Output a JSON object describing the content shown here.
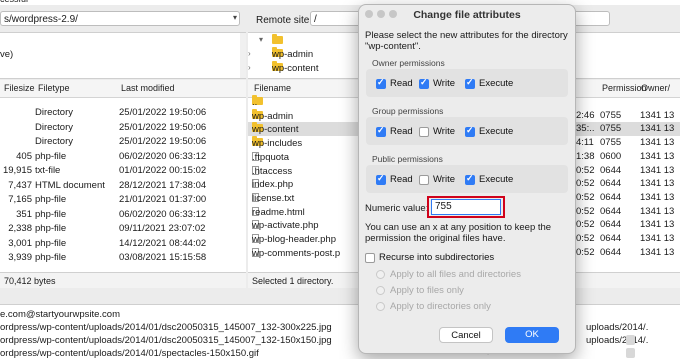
{
  "status_top": "cessful",
  "local_site": {
    "path": "s/wordpress-2.9/"
  },
  "remote_site": {
    "label": "Remote site:",
    "path": "/"
  },
  "local_tree": {
    "item": "ve)"
  },
  "remote_tree": {
    "items": [
      "wp-admin",
      "wp-content"
    ]
  },
  "local_list": {
    "columns": [
      "Filesize",
      "Filetype",
      "Last modified"
    ],
    "rows": [
      {
        "size": "",
        "type": "Directory",
        "modified": "25/01/2022 19:50:06"
      },
      {
        "size": "",
        "type": "Directory",
        "modified": "25/01/2022 19:50:06"
      },
      {
        "size": "",
        "type": "Directory",
        "modified": "25/01/2022 19:50:06"
      },
      {
        "size": "405",
        "type": "php-file",
        "modified": "06/02/2020 06:33:12"
      },
      {
        "size": "19,915",
        "type": "txt-file",
        "modified": "01/01/2022 00:15:02"
      },
      {
        "size": "7,437",
        "type": "HTML document",
        "modified": "28/12/2021 17:38:04"
      },
      {
        "size": "7,165",
        "type": "php-file",
        "modified": "21/01/2021 01:37:00"
      },
      {
        "size": "351",
        "type": "php-file",
        "modified": "06/02/2020 06:33:12"
      },
      {
        "size": "2,338",
        "type": "php-file",
        "modified": "09/11/2021 23:07:02"
      },
      {
        "size": "3,001",
        "type": "php-file",
        "modified": "14/12/2021 08:44:02"
      },
      {
        "size": "3,939",
        "type": "php-file",
        "modified": "03/08/2021 15:15:58"
      }
    ],
    "footer": "70,412 bytes"
  },
  "remote_list": {
    "columns": [
      "Filename",
      "Permission",
      "Owner/"
    ],
    "rows": [
      {
        "name": "..",
        "folder": true,
        "time": "",
        "perm": "",
        "owner": ""
      },
      {
        "name": "wp-admin",
        "folder": true,
        "time": "2:46",
        "perm": "0755",
        "owner": "1341 13"
      },
      {
        "name": "wp-content",
        "folder": true,
        "time": "35:..",
        "perm": "0755",
        "owner": "1341 13"
      },
      {
        "name": "wp-includes",
        "folder": true,
        "time": "4:11",
        "perm": "0755",
        "owner": "1341 13"
      },
      {
        "name": ".ftpquota",
        "folder": false,
        "time": "1:38",
        "perm": "0600",
        "owner": "1341 13"
      },
      {
        "name": ".htaccess",
        "folder": false,
        "time": "0:52",
        "perm": "0644",
        "owner": "1341 13"
      },
      {
        "name": "index.php",
        "folder": false,
        "time": "0:52",
        "perm": "0644",
        "owner": "1341 13"
      },
      {
        "name": "license.txt",
        "folder": false,
        "time": "0:52",
        "perm": "0644",
        "owner": "1341 13"
      },
      {
        "name": "readme.html",
        "folder": false,
        "time": "0:52",
        "perm": "0644",
        "owner": "1341 13"
      },
      {
        "name": "wp-activate.php",
        "folder": false,
        "time": "0:52",
        "perm": "0644",
        "owner": "1341 13"
      },
      {
        "name": "wp-blog-header.php",
        "folder": false,
        "time": "0:52",
        "perm": "0644",
        "owner": "1341 13"
      },
      {
        "name": "wp-comments-post.p",
        "folder": false,
        "time": "0:52",
        "perm": "0644",
        "owner": "1341 13"
      }
    ],
    "footer": "Selected 1 directory."
  },
  "queue": {
    "lines": [
      "e.com@startyourwpsite.com",
      "ordpress/wp-content/uploads/2014/01/dsc20050315_145007_132-300x225.jpg",
      "ordpress/wp-content/uploads/2014/01/dsc20050315_145007_132-150x150.jpg",
      "ordpress/wp-content/uploads/2014/01/spectacles-150x150.gif"
    ],
    "right_lines": [
      "uploads/2014/.",
      "uploads/2014/.",
      "<--"
    ]
  },
  "dialog": {
    "title": "Change file attributes",
    "intro": [
      "Please select the new attributes for the directory",
      "\"wp-content\"."
    ],
    "groups": [
      {
        "label": "Owner permissions",
        "read": true,
        "write": true,
        "execute": true
      },
      {
        "label": "Group permissions",
        "read": true,
        "write": false,
        "execute": true
      },
      {
        "label": "Public permissions",
        "read": true,
        "write": false,
        "execute": true
      }
    ],
    "perm_labels": {
      "read": "Read",
      "write": "Write",
      "execute": "Execute"
    },
    "numeric_label": "Numeric value:",
    "numeric_value": "755",
    "hint": [
      "You can use an x at any position to keep the",
      "permission the original files have."
    ],
    "recurse_label": "Recurse into subdirectories",
    "recurse_options": [
      "Apply to all files and directories",
      "Apply to files only",
      "Apply to directories only"
    ],
    "cancel": "Cancel",
    "ok": "OK",
    "accent": "#2f7bf5",
    "highlight": "#d0021b"
  }
}
